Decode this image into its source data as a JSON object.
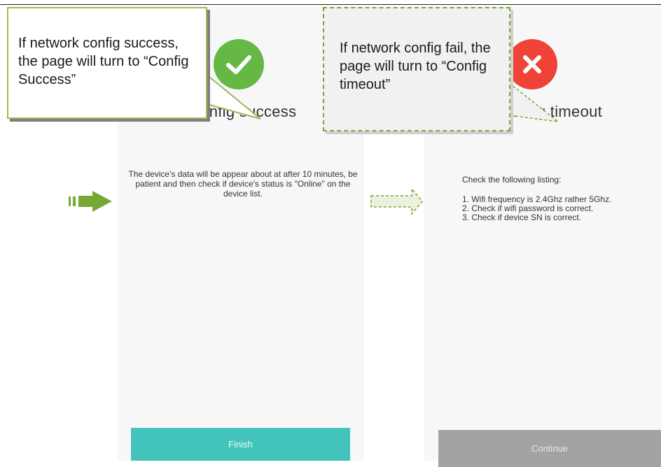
{
  "success_screen": {
    "title": "Config success",
    "message": "The device's data will be appear about at after 10 minutes,  be patient and then check if device's status is \"Online\" on the device list.",
    "button_label": "Finish",
    "icon": "checkmark-icon",
    "accent_color": "#42c4bd"
  },
  "timeout_screen": {
    "title": "Config timeout",
    "heading": "Check the following listing:",
    "items": [
      "1. Wifi frequency is 2.4Ghz rather 5Ghz.",
      "2. Check if wifi password is correct.",
      "3. Check if device SN is correct."
    ],
    "button_label": "Continue",
    "icon": "cross-icon",
    "button_color": "#a3a3a3"
  },
  "callouts": {
    "success": "If network config success, the page will turn to “Config Success”",
    "fail": "If network config fail, the page will turn to “Config timeout”"
  },
  "colors": {
    "success_green": "#66b845",
    "error_red": "#ee4336",
    "callout_border": "#9bbb59",
    "arrow_green": "#77a836"
  }
}
